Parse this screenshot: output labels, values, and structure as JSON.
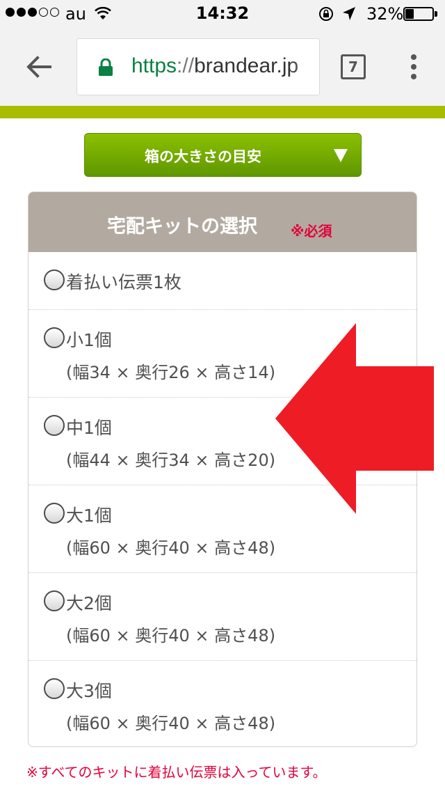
{
  "status_bar": {
    "carrier": "au",
    "time": "14:32",
    "battery_percent": "32%",
    "battery_level": 0.32
  },
  "browser": {
    "url_scheme": "https",
    "url_separator": "://",
    "url_host": "brandear.jp",
    "tab_count": "7"
  },
  "guide_button": {
    "label": "箱の大きさの目安"
  },
  "kit_selection": {
    "title": "宅配キットの選択",
    "required_label": "※必須",
    "options": [
      {
        "label": "着払い伝票1枚",
        "dims": ""
      },
      {
        "label": "小1個",
        "dims": "(幅34 × 奥行26 × 高さ14)"
      },
      {
        "label": "中1個",
        "dims": "(幅44 × 奥行34 × 高さ20)"
      },
      {
        "label": "大1個",
        "dims": "(幅60 × 奥行40 × 高さ48)"
      },
      {
        "label": "大2個",
        "dims": "(幅60 × 奥行40 × 高さ48)"
      },
      {
        "label": "大3個",
        "dims": "(幅60 × 奥行40 × 高さ48)"
      }
    ]
  },
  "footnote": "※すべてのキットに着払い伝票は入っています。",
  "colors": {
    "accent_green": "#6aa800",
    "header_taupe": "#b2aaa0",
    "required_red": "#e4003a",
    "arrow_red": "#ee1c25"
  }
}
